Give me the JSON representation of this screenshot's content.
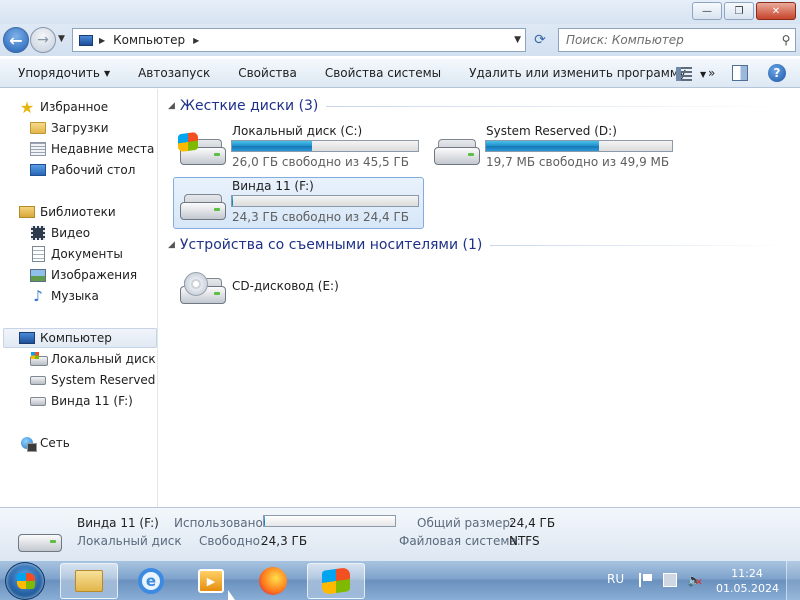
{
  "window": {
    "controls": {
      "minimize": "—",
      "maximize": "❐",
      "close": "✕"
    }
  },
  "nav": {
    "back_icon": "back-arrow-icon",
    "forward_icon": "forward-arrow-icon",
    "address": {
      "location": "Компьютер"
    },
    "search": {
      "placeholder": "Поиск: Компьютер"
    }
  },
  "toolbar": {
    "items": [
      {
        "label": "Упорядочить",
        "has_dropdown": true
      },
      {
        "label": "Автозапуск"
      },
      {
        "label": "Свойства"
      },
      {
        "label": "Свойства системы"
      },
      {
        "label": "Удалить или изменить программу"
      }
    ],
    "more": "»"
  },
  "sidebar": {
    "favorites": {
      "label": "Избранное",
      "items": [
        {
          "label": "Загрузки",
          "icon": "downloads-folder-icon"
        },
        {
          "label": "Недавние места",
          "icon": "recent-places-icon"
        },
        {
          "label": "Рабочий стол",
          "icon": "desktop-icon"
        }
      ]
    },
    "libraries": {
      "label": "Библиотеки",
      "items": [
        {
          "label": "Видео",
          "icon": "video-icon"
        },
        {
          "label": "Документы",
          "icon": "documents-icon"
        },
        {
          "label": "Изображения",
          "icon": "images-icon"
        },
        {
          "label": "Музыка",
          "icon": "music-icon"
        }
      ]
    },
    "computer": {
      "label": "Компьютер",
      "selected": true,
      "items": [
        {
          "label": "Локальный диск (C:)",
          "icon": "windows-drive-icon"
        },
        {
          "label": "System Reserved (D:)",
          "icon": "drive-icon"
        },
        {
          "label": "Винда 11 (F:)",
          "icon": "drive-icon"
        }
      ]
    },
    "network": {
      "label": "Сеть"
    }
  },
  "content": {
    "hard_disks": {
      "header": "Жесткие диски (3)",
      "drives": [
        {
          "name": "Локальный диск (C:)",
          "free_text": "26,0 ГБ свободно из 45,5 ГБ",
          "used_fraction": 0.43,
          "icon": "windows-drive-icon",
          "selected": false
        },
        {
          "name": "System Reserved (D:)",
          "free_text": "19,7 МБ свободно из 49,9 МБ",
          "used_fraction": 0.61,
          "icon": "drive-icon",
          "selected": false
        },
        {
          "name": "Винда 11 (F:)",
          "free_text": "24,3 ГБ свободно из 24,4 ГБ",
          "used_fraction": 0.004,
          "icon": "drive-icon",
          "selected": true
        }
      ]
    },
    "removable": {
      "header": "Устройства со съемными носителями (1)",
      "devices": [
        {
          "name": "CD-дисковод (E:)",
          "icon": "cd-drive-icon"
        }
      ]
    }
  },
  "details": {
    "name": "Винда 11 (F:)",
    "type": "Локальный диск",
    "used_label": "Использовано:",
    "used_fraction": 0.004,
    "free_label": "Свободно:",
    "free_value": "24,3 ГБ",
    "total_label": "Общий размер:",
    "total_value": "24,4 ГБ",
    "fs_label": "Файловая система:",
    "fs_value": "NTFS"
  },
  "taskbar": {
    "apps": [
      {
        "name": "Проводник",
        "icon": "explorer-icon",
        "active": true
      },
      {
        "name": "Internet Explorer",
        "icon": "internet-explorer-icon",
        "active": false
      },
      {
        "name": "Media Player",
        "icon": "media-player-icon",
        "active": false
      },
      {
        "name": "Firefox",
        "icon": "firefox-icon",
        "active": false
      },
      {
        "name": "Windows",
        "icon": "windows-flag-icon",
        "active": true
      }
    ],
    "tray": {
      "language": "RU",
      "time": "11:24",
      "date": "01.05.2024"
    }
  }
}
